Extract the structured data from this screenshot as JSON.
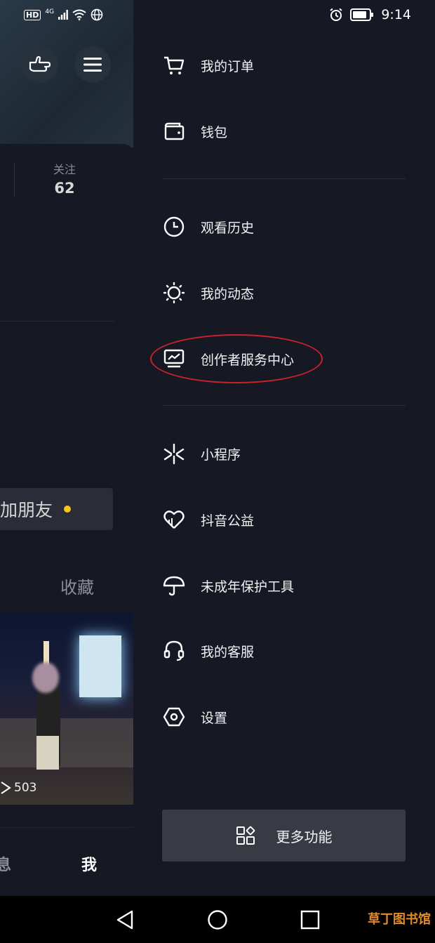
{
  "status_bar": {
    "time": "9:14",
    "network": "4G",
    "hd": "HD"
  },
  "background": {
    "follow_label": "关注",
    "follow_count": "62",
    "add_friend_label": "加朋友",
    "collect_tab": "收藏",
    "video_views": "503",
    "nav_message": "息",
    "nav_me": "我"
  },
  "drawer": {
    "items": [
      {
        "label": "我的订单",
        "icon": "cart-icon"
      },
      {
        "label": "钱包",
        "icon": "wallet-icon"
      },
      {
        "label": "观看历史",
        "icon": "clock-icon"
      },
      {
        "label": "我的动态",
        "icon": "sun-icon"
      },
      {
        "label": "创作者服务中心",
        "icon": "chart-monitor-icon"
      },
      {
        "label": "小程序",
        "icon": "mini-program-icon"
      },
      {
        "label": "抖音公益",
        "icon": "heart-icon"
      },
      {
        "label": "未成年保护工具",
        "icon": "umbrella-icon"
      },
      {
        "label": "我的客服",
        "icon": "headset-icon"
      },
      {
        "label": "设置",
        "icon": "hexagon-settings-icon"
      }
    ],
    "more_label": "更多功能"
  },
  "watermark": "草丁图书馆",
  "colors": {
    "drawer_bg": "#161823",
    "annotation_red": "#c8232c",
    "accent_yellow": "#f5c518"
  }
}
